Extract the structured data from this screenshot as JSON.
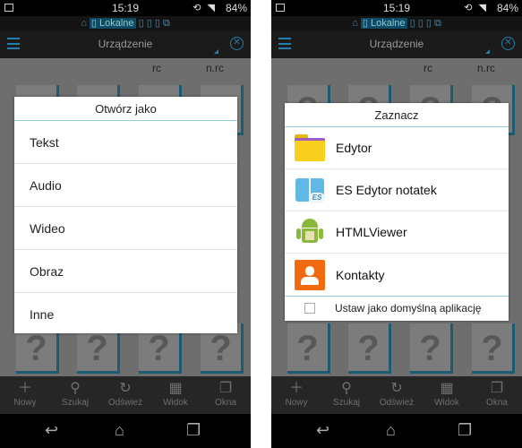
{
  "status": {
    "time": "15:19",
    "battery": "84%"
  },
  "location_tabs": {
    "active": "Lokalne"
  },
  "toolbar": {
    "title": "Urządzenie"
  },
  "files": {
    "labels": [
      "rc",
      "n.rc"
    ]
  },
  "bottom_bar": [
    {
      "icon": "plus-icon",
      "label": "Nowy"
    },
    {
      "icon": "search-icon",
      "label": "Szukaj"
    },
    {
      "icon": "refresh-icon",
      "label": "Odśwież"
    },
    {
      "icon": "grid-view-icon",
      "label": "Widok"
    },
    {
      "icon": "windows-icon",
      "label": "Okna"
    }
  ],
  "open_as_dialog": {
    "title": "Otwórz jako",
    "items": [
      "Tekst",
      "Audio",
      "Wideo",
      "Obraz",
      "Inne"
    ]
  },
  "choose_app_dialog": {
    "title": "Zaznacz",
    "apps": [
      {
        "icon": "folder-icon",
        "label": "Edytor"
      },
      {
        "icon": "es-note-editor-icon",
        "label": "ES Edytor notatek"
      },
      {
        "icon": "android-icon",
        "label": "HTMLViewer"
      },
      {
        "icon": "contacts-icon",
        "label": "Kontakty"
      }
    ],
    "default_checkbox": {
      "label": "Ustaw jako domyślną aplikację",
      "checked": false
    }
  },
  "colors": {
    "accent": "#237ea8",
    "dialog_divider": "#8fd3ea",
    "contacts": "#f26a10",
    "folder": "#f8cf1c"
  }
}
